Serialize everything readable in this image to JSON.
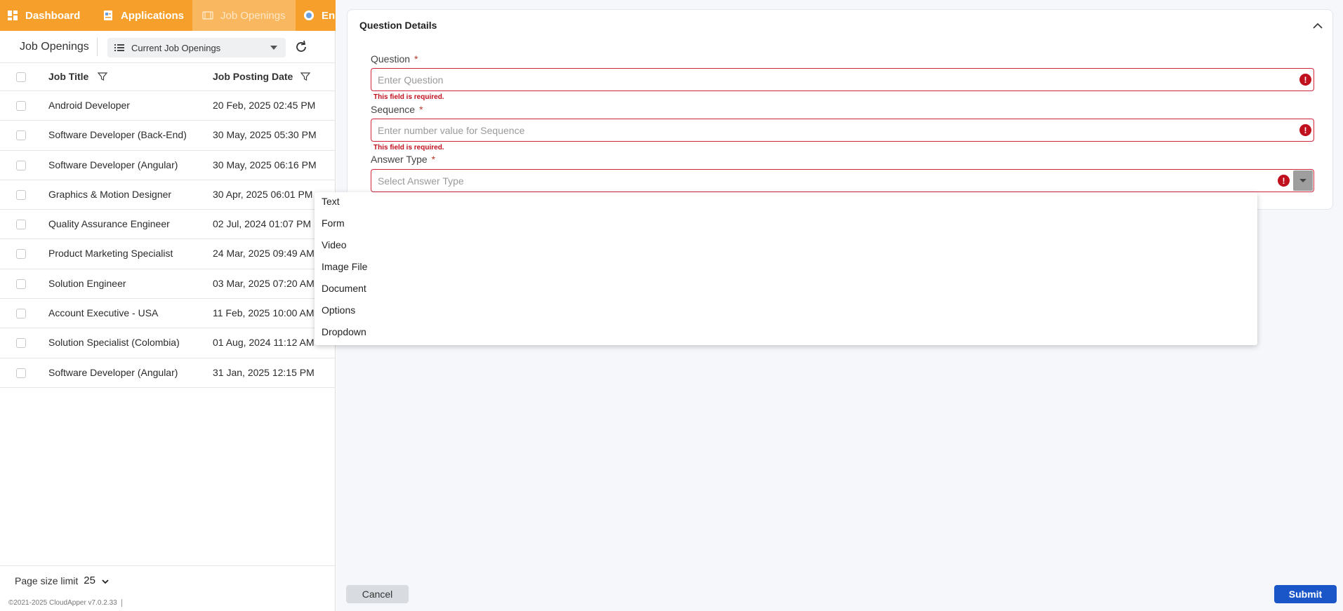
{
  "nav": {
    "tabs": [
      {
        "label": "Dashboard",
        "icon": "dashboard-icon"
      },
      {
        "label": "Applications",
        "icon": "applications-icon"
      },
      {
        "label": "Job Openings",
        "icon": "job-openings-icon",
        "active": true
      },
      {
        "label": "En",
        "icon": "employee-icon"
      }
    ],
    "bar_color": "#f6a02b"
  },
  "toolbar": {
    "title": "Job Openings",
    "view_label": "Current Job Openings",
    "refresh_icon": "refresh-icon"
  },
  "table": {
    "columns": [
      "Job Title",
      "Job Posting Date"
    ],
    "rows": [
      {
        "title": "Android Developer",
        "date": "20 Feb, 2025 02:45 PM"
      },
      {
        "title": "Software Developer (Back-End)",
        "date": "30 May, 2025 05:30 PM"
      },
      {
        "title": "Software Developer (Angular)",
        "date": "30 May, 2025 06:16 PM"
      },
      {
        "title": "Graphics & Motion Designer",
        "date": "30 Apr, 2025 06:01 PM"
      },
      {
        "title": "Quality Assurance Engineer",
        "date": "02 Jul, 2024 01:07 PM"
      },
      {
        "title": "Product Marketing Specialist",
        "date": "24 Mar, 2025 09:49 AM"
      },
      {
        "title": "Solution Engineer",
        "date": "03 Mar, 2025 07:20 AM"
      },
      {
        "title": "Account Executive - USA",
        "date": "11 Feb, 2025 10:00 AM"
      },
      {
        "title": "Solution Specialist (Colombia)",
        "date": "01 Aug, 2024 11:12 AM"
      },
      {
        "title": "Software Developer (Angular)",
        "date": "31 Jan, 2025 12:15 PM"
      }
    ]
  },
  "footer": {
    "page_size_label": "Page size limit",
    "page_size_value": "25",
    "copyright": "©2021-2025 CloudApper v7.0.2.33"
  },
  "form": {
    "section_title": "Question Details",
    "question": {
      "label": "Question",
      "required": "*",
      "placeholder": "Enter Question",
      "error": "This field is required."
    },
    "sequence": {
      "label": "Sequence",
      "required": "*",
      "placeholder": "Enter number value for Sequence",
      "error": "This field is required."
    },
    "answer_type": {
      "label": "Answer Type",
      "required": "*",
      "placeholder": "Select Answer Type",
      "options": [
        "Text",
        "Form",
        "Video",
        "Image File",
        "Document",
        "Options",
        "Dropdown"
      ]
    },
    "error_color": "#c0101e"
  },
  "actions": {
    "cancel": "Cancel",
    "submit": "Submit",
    "submit_color": "#1a56c8"
  }
}
